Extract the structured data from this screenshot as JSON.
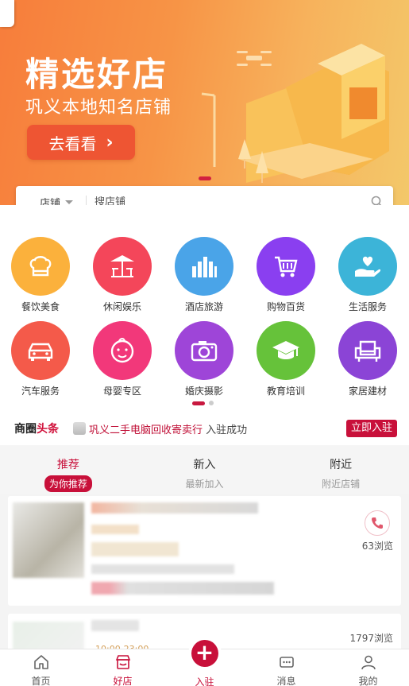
{
  "banner": {
    "title": "精选好店",
    "subtitle": "巩义本地知名店铺",
    "button_label": "去看看"
  },
  "search": {
    "scope_label": "店铺",
    "placeholder": "搜店铺"
  },
  "categories": [
    {
      "label": "餐饮美食",
      "color": "#fbb13c",
      "icon": "chef-hat-icon"
    },
    {
      "label": "休闲娱乐",
      "color": "#f4465a",
      "icon": "umbrella-table-icon"
    },
    {
      "label": "酒店旅游",
      "color": "#4aa4e8",
      "icon": "city-skyline-icon"
    },
    {
      "label": "购物百货",
      "color": "#8a3ff0",
      "icon": "shopping-cart-icon"
    },
    {
      "label": "生活服务",
      "color": "#3cb4d8",
      "icon": "heart-hand-icon"
    },
    {
      "label": "汽车服务",
      "color": "#f45a4a",
      "icon": "car-icon"
    },
    {
      "label": "母婴专区",
      "color": "#f2387a",
      "icon": "baby-face-icon"
    },
    {
      "label": "婚庆摄影",
      "color": "#9e45d8",
      "icon": "camera-icon"
    },
    {
      "label": "教育培训",
      "color": "#66c23a",
      "icon": "graduation-cap-icon"
    },
    {
      "label": "家居建材",
      "color": "#8b44d6",
      "icon": "armchair-icon"
    }
  ],
  "news": {
    "brand_a": "商圈",
    "brand_b": "头条",
    "headline": "巩义二手电脑回收寄卖行",
    "headline_suffix": " 入驻成功",
    "join_label": "立即入驻"
  },
  "tabs": [
    {
      "title": "推荐",
      "subtitle": "为你推荐"
    },
    {
      "title": "新入",
      "subtitle": "最新加入"
    },
    {
      "title": "附近",
      "subtitle": "附近店铺"
    }
  ],
  "cards": [
    {
      "views": "63浏览"
    },
    {
      "views": "1797浏览",
      "hours": "10:00-23:00"
    }
  ],
  "tabbar": [
    {
      "label": "首页",
      "icon": "home-icon"
    },
    {
      "label": "好店",
      "icon": "shop-icon"
    },
    {
      "label": "入驻",
      "icon": "plus-icon"
    },
    {
      "label": "消息",
      "icon": "message-icon"
    },
    {
      "label": "我的",
      "icon": "user-icon"
    }
  ],
  "colors": {
    "brand": "#c8103a",
    "banner_button": "#ee5533"
  }
}
